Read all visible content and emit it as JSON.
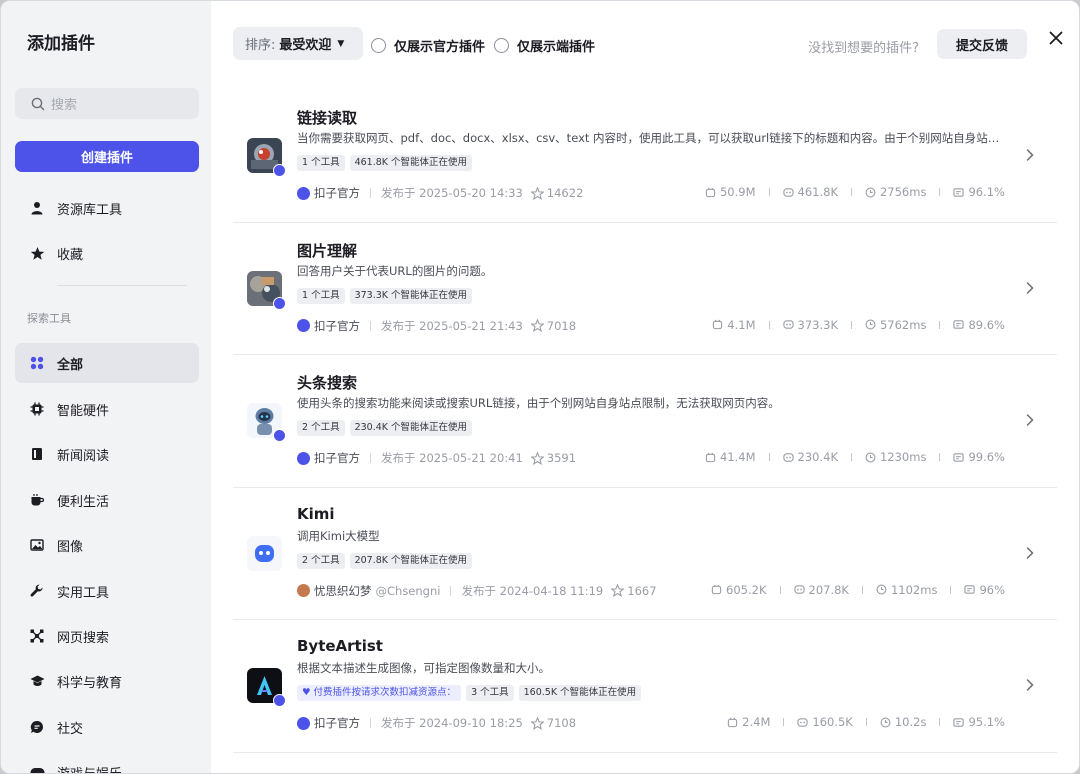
{
  "sidebar": {
    "title": "添加插件",
    "search_placeholder": "搜索",
    "create_label": "创建插件",
    "items": [
      {
        "label": "资源库工具"
      },
      {
        "label": "收藏"
      }
    ],
    "section_label": "探索工具",
    "categories": [
      {
        "label": "全部"
      },
      {
        "label": "智能硬件"
      },
      {
        "label": "新闻阅读"
      },
      {
        "label": "便利生活"
      },
      {
        "label": "图像"
      },
      {
        "label": "实用工具"
      },
      {
        "label": "网页搜索"
      },
      {
        "label": "科学与教育"
      },
      {
        "label": "社交"
      },
      {
        "label": "游戏与娱乐"
      }
    ]
  },
  "toolbar": {
    "sort_label": "排序:",
    "sort_value": "最受欢迎",
    "official_only": "仅展示官方插件",
    "client_only": "仅展示端插件",
    "hint": "没找到想要的插件?",
    "feedback": "提交反馈"
  },
  "plugins": [
    {
      "title": "链接读取",
      "desc": "当你需要获取网页、pdf、doc、docx、xlsx、csv、text 内容时，使用此工具，可以获取url链接下的标题和内容。由于个别网站自身站点…",
      "tags": [
        "1 个工具",
        "461.8K 个智能体正在使用"
      ],
      "author": "扣子官方",
      "published": "发布于 2025-05-20 14:33",
      "stars": "14622",
      "calls": "50.9M",
      "bots": "461.8K",
      "latency": "2756ms",
      "success": "96.1%"
    },
    {
      "title": "图片理解",
      "desc": "回答用户关于代表URL的图片的问题。",
      "tags": [
        "1 个工具",
        "373.3K 个智能体正在使用"
      ],
      "author": "扣子官方",
      "published": "发布于 2025-05-21 21:43",
      "stars": "7018",
      "calls": "4.1M",
      "bots": "373.3K",
      "latency": "5762ms",
      "success": "89.6%"
    },
    {
      "title": "头条搜索",
      "desc": "使用头条的搜索功能来阅读或搜索URL链接，由于个别网站自身站点限制，无法获取网页内容。",
      "tags": [
        "2 个工具",
        "230.4K 个智能体正在使用"
      ],
      "author": "扣子官方",
      "published": "发布于 2025-05-21 20:41",
      "stars": "3591",
      "calls": "41.4M",
      "bots": "230.4K",
      "latency": "1230ms",
      "success": "99.6%"
    },
    {
      "title": "Kimi",
      "desc": "调用Kimi大模型",
      "tags": [
        "2 个工具",
        "207.8K 个智能体正在使用"
      ],
      "author": "忧思织幻梦",
      "handle": "@Chsengni",
      "published": "发布于 2024-04-18 11:19",
      "stars": "1667",
      "calls": "605.2K",
      "bots": "207.8K",
      "latency": "1102ms",
      "success": "96%"
    },
    {
      "title": "ByteArtist",
      "desc": "根据文本描述生成图像，可指定图像数量和大小。",
      "paid_tag": "付费插件按请求次数扣减资源点：",
      "tags": [
        "3 个工具",
        "160.5K 个智能体正在使用"
      ],
      "author": "扣子官方",
      "published": "发布于 2024-09-10 18:25",
      "stars": "7108",
      "calls": "2.4M",
      "bots": "160.5K",
      "latency": "10.2s",
      "success": "95.1%"
    }
  ],
  "colors": {
    "accent": "#4d53e8",
    "sidebar_bg": "#f2f3f5"
  }
}
